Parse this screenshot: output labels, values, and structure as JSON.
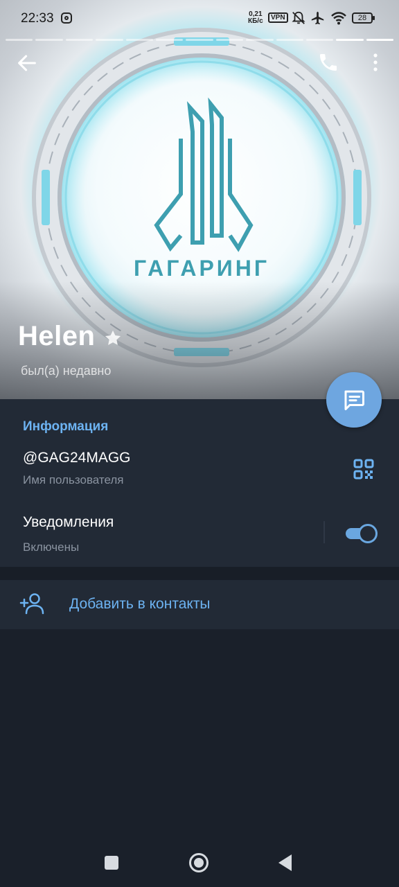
{
  "status_bar": {
    "time": "22:33",
    "net_speed_value": "0,21",
    "net_speed_unit": "КБ/с",
    "vpn": "VPN",
    "battery": "28"
  },
  "hero": {
    "logo_text": "ГАГАРИНГ"
  },
  "profile": {
    "name": "Helen",
    "last_seen": "был(а) недавно"
  },
  "info": {
    "section_title": "Информация",
    "username": "@GAG24MAGG",
    "username_label": "Имя пользователя",
    "notifications_label": "Уведомления",
    "notifications_state": "Включены",
    "notifications_enabled": true
  },
  "actions": {
    "add_contact": "Добавить в контакты"
  },
  "colors": {
    "accent": "#6db3f2",
    "fab": "#6ea6e0",
    "panel": "#222a36",
    "background": "#1a202a"
  },
  "icons": [
    "back-arrow-icon",
    "phone-icon",
    "more-vertical-icon",
    "star-icon",
    "message-icon",
    "qr-code-icon",
    "add-person-icon",
    "instagram-icon",
    "mute-icon",
    "airplane-icon",
    "wifi-icon",
    "battery-icon"
  ]
}
